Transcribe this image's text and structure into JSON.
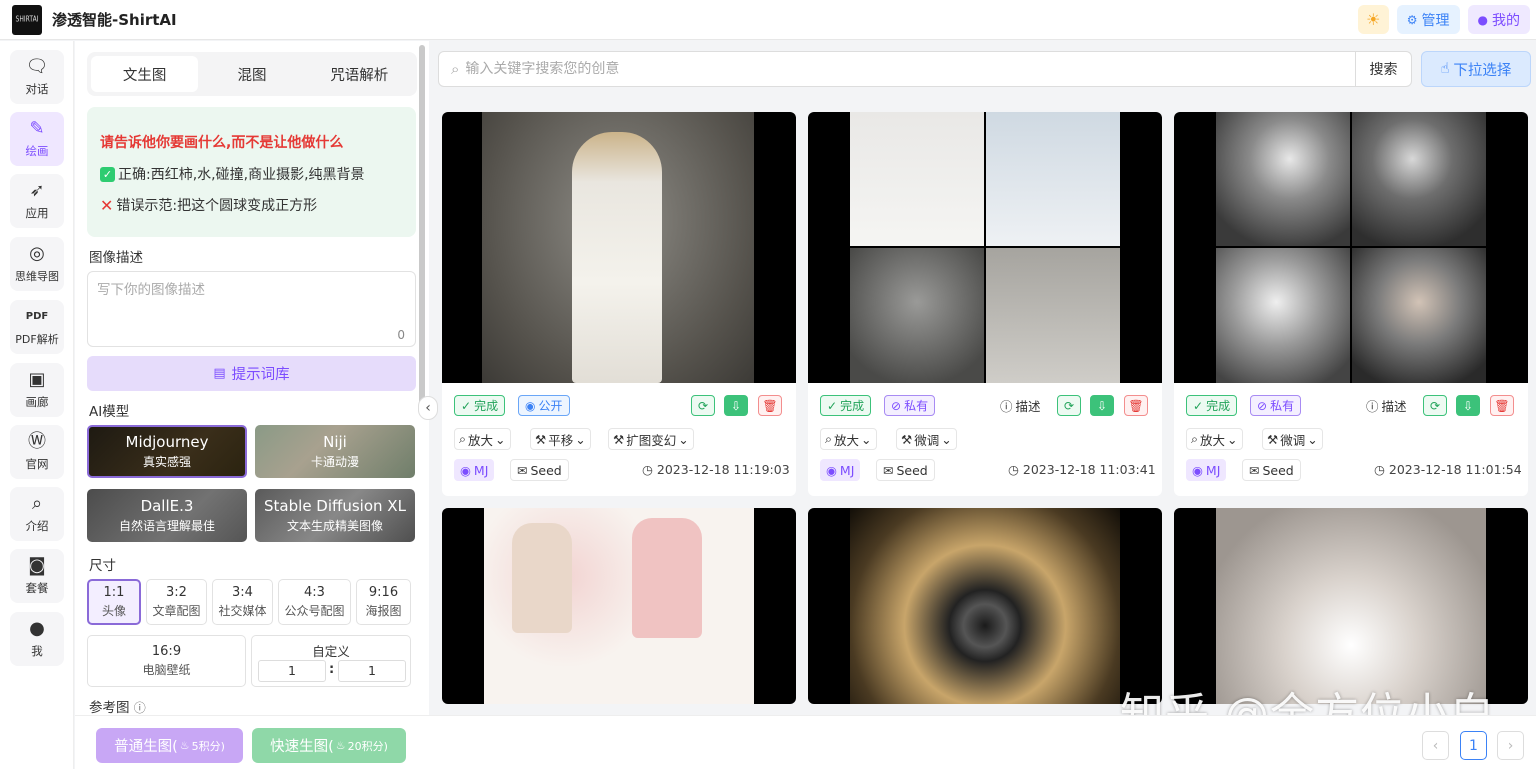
{
  "header": {
    "logo_text": "SHIRTAI",
    "title": "渗透智能-ShirtAI",
    "admin": "管理",
    "mine": "我的"
  },
  "nav": [
    {
      "label": "对话",
      "icon": "chat-icon"
    },
    {
      "label": "绘画",
      "icon": "brush-icon"
    },
    {
      "label": "应用",
      "icon": "rocket-icon"
    },
    {
      "label": "思维导图",
      "icon": "mindmap-icon"
    },
    {
      "label": "PDF解析",
      "icon": "pdf-icon"
    },
    {
      "label": "画廊",
      "icon": "gallery-icon"
    },
    {
      "label": "官网",
      "icon": "wordpress-icon"
    },
    {
      "label": "介绍",
      "icon": "search-icon"
    },
    {
      "label": "套餐",
      "icon": "shop-icon"
    },
    {
      "label": "我",
      "icon": "user-icon"
    }
  ],
  "tabs": [
    "文生图",
    "混图",
    "咒语解析"
  ],
  "tips": {
    "warn": "请告诉他你要画什么,而不是让他做什么",
    "ok": "正确:西红柿,水,碰撞,商业摄影,纯黑背景",
    "bad": "错误示范:把这个圆球变成正方形"
  },
  "desc": {
    "label": "图像描述",
    "placeholder": "写下你的图像描述",
    "count": "0"
  },
  "prompt_lib": "提示词库",
  "models_label": "AI模型",
  "models": [
    {
      "name": "Midjourney",
      "sub": "真实感强"
    },
    {
      "name": "Niji",
      "sub": "卡通动漫"
    },
    {
      "name": "DallE.3",
      "sub": "自然语言理解最佳"
    },
    {
      "name": "Stable Diffusion XL",
      "sub": "文本生成精美图像"
    }
  ],
  "size_label": "尺寸",
  "sizes": [
    {
      "ratio": "1:1",
      "name": "头像"
    },
    {
      "ratio": "3:2",
      "name": "文章配图"
    },
    {
      "ratio": "3:4",
      "name": "社交媒体"
    },
    {
      "ratio": "4:3",
      "name": "公众号配图"
    },
    {
      "ratio": "9:16",
      "name": "海报图"
    },
    {
      "ratio": "16:9",
      "name": "电脑壁纸"
    }
  ],
  "custom": {
    "label": "自定义",
    "w": "1",
    "sep": ":",
    "h": "1"
  },
  "ref_label": "参考图",
  "gen": {
    "normal": "普通生图(",
    "normal_cost": "5积分)",
    "fast": "快速生图(",
    "fast_cost": "20积分)"
  },
  "search": {
    "placeholder": "输入关键字搜索您的创意",
    "button": "搜索",
    "dropdown": "下拉选择"
  },
  "cards": [
    {
      "status": "完成",
      "visibility": "公开",
      "actions": [
        "放大",
        "平移",
        "扩图变幻"
      ],
      "model": "MJ",
      "seed": "Seed",
      "time": "2023-12-18 11:19:03"
    },
    {
      "status": "完成",
      "visibility": "私有",
      "describe": "描述",
      "actions": [
        "放大",
        "微调"
      ],
      "model": "MJ",
      "seed": "Seed",
      "time": "2023-12-18 11:03:41"
    },
    {
      "status": "完成",
      "visibility": "私有",
      "describe": "描述",
      "actions": [
        "放大",
        "微调"
      ],
      "model": "MJ",
      "seed": "Seed",
      "time": "2023-12-18 11:01:54"
    }
  ],
  "pager": {
    "prev": "‹",
    "page": "1",
    "next": "›"
  },
  "watermark": "知乎 @全方位小白"
}
